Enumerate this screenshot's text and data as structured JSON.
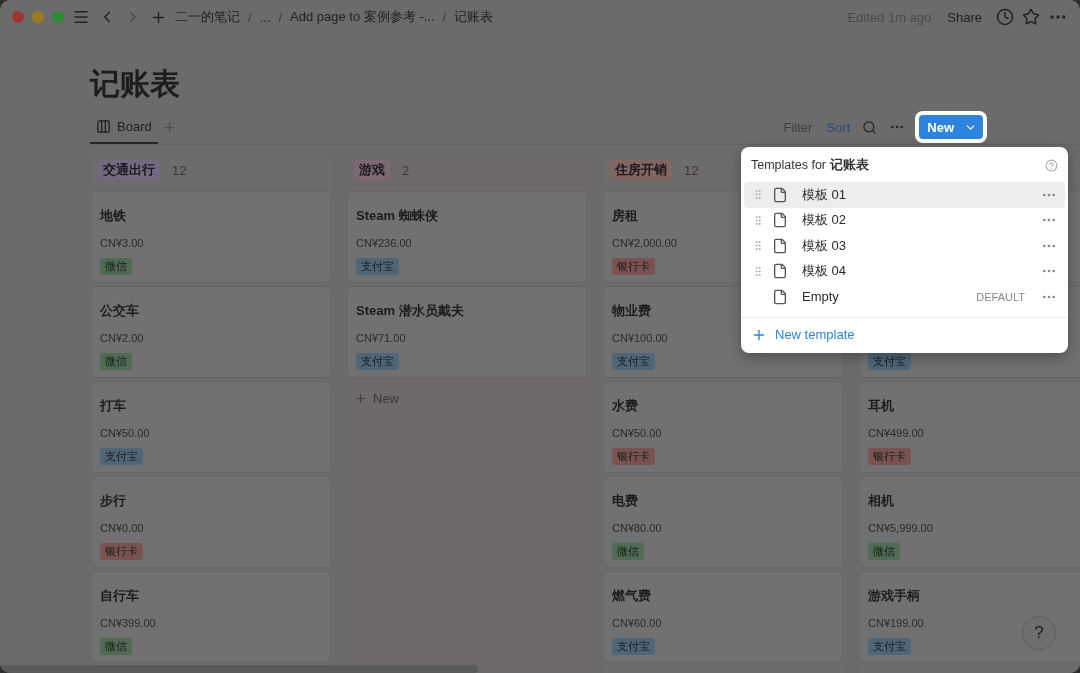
{
  "breadcrumbs": {
    "separator": "/",
    "items": [
      "二一的笔记",
      "...",
      "Add page to 案例参考 -...",
      "记账表"
    ]
  },
  "edited": "Edited 1m ago",
  "share": "Share",
  "page_title": "记账表",
  "views": [
    {
      "label": "Board",
      "selected": true
    }
  ],
  "toolbar": {
    "filter": "Filter",
    "sort": "Sort",
    "sort_active": true,
    "new": "New"
  },
  "columns": [
    {
      "name": "交通出行",
      "count": "12",
      "color": "#746a80",
      "cards": [
        {
          "title": "地铁",
          "amount": "CN¥3.00",
          "tag": {
            "label": "微信",
            "color": "#4f6b55"
          }
        },
        {
          "title": "公交车",
          "amount": "CN¥2.00",
          "tag": {
            "label": "微信",
            "color": "#4f6b55"
          }
        },
        {
          "title": "打车",
          "amount": "CN¥50.00",
          "tag": {
            "label": "支付宝",
            "color": "#4f6678"
          }
        },
        {
          "title": "步行",
          "amount": "CN¥0.00",
          "tag": {
            "label": "银行卡",
            "color": "#7a5252"
          }
        },
        {
          "title": "自行车",
          "amount": "CN¥399.00",
          "tag": {
            "label": "微信",
            "color": "#4f6b55"
          }
        }
      ]
    },
    {
      "name": "游戏",
      "count": "2",
      "color": "#7e6872",
      "add_label": "New",
      "cards": [
        {
          "title": "Steam 蜘蛛侠",
          "amount": "CN¥236.00",
          "tag": {
            "label": "支付宝",
            "color": "#4f6678"
          }
        },
        {
          "title": "Steam 潜水员戴夫",
          "amount": "CN¥71.00",
          "tag": {
            "label": "支付宝",
            "color": "#4f6678"
          }
        }
      ]
    },
    {
      "name": "住房开销",
      "count": "12",
      "color": "#806762",
      "cards": [
        {
          "title": "房租",
          "amount": "CN¥2,000.00",
          "tag": {
            "label": "银行卡",
            "color": "#7a5252"
          }
        },
        {
          "title": "物业费",
          "amount": "CN¥100.00",
          "tag": {
            "label": "支付宝",
            "color": "#4f6678"
          }
        },
        {
          "title": "水费",
          "amount": "CN¥50.00",
          "tag": {
            "label": "银行卡",
            "color": "#7a5252"
          }
        },
        {
          "title": "电费",
          "amount": "CN¥80.00",
          "tag": {
            "label": "微信",
            "color": "#4f6b55"
          }
        },
        {
          "title": "燃气费",
          "amount": "CN¥60.00",
          "tag": {
            "label": "支付宝",
            "color": "#4f6678"
          }
        }
      ]
    },
    {
      "cards": [
        {
          "kind": "covered"
        },
        {
          "kind": "card",
          "tag": {
            "label": "支付宝",
            "color": "#4f6678"
          }
        },
        {
          "title": "耳机",
          "amount": "CN¥499.00",
          "tag": {
            "label": "银行卡",
            "color": "#7a5252"
          }
        },
        {
          "title": "相机",
          "amount": "CN¥5,999.00",
          "tag": {
            "label": "微信",
            "color": "#4f6b55"
          }
        },
        {
          "title": "游戏手柄",
          "amount": "CN¥199.00",
          "tag": {
            "label": "支付宝",
            "color": "#4f6678"
          }
        }
      ]
    }
  ],
  "templates_menu": {
    "title": "Templates for **记账表**",
    "items": [
      {
        "label": "模板 01",
        "selected": true,
        "draggable": true
      },
      {
        "label": "模板 02",
        "selected": false,
        "draggable": true
      },
      {
        "label": "模板 03",
        "selected": false,
        "draggable": true
      },
      {
        "label": "模板 04",
        "selected": false,
        "draggable": true
      },
      {
        "label": "Empty",
        "selected": false,
        "draggable": false,
        "badge": "DEFAULT"
      }
    ],
    "new_template": "New template"
  },
  "help": "?"
}
